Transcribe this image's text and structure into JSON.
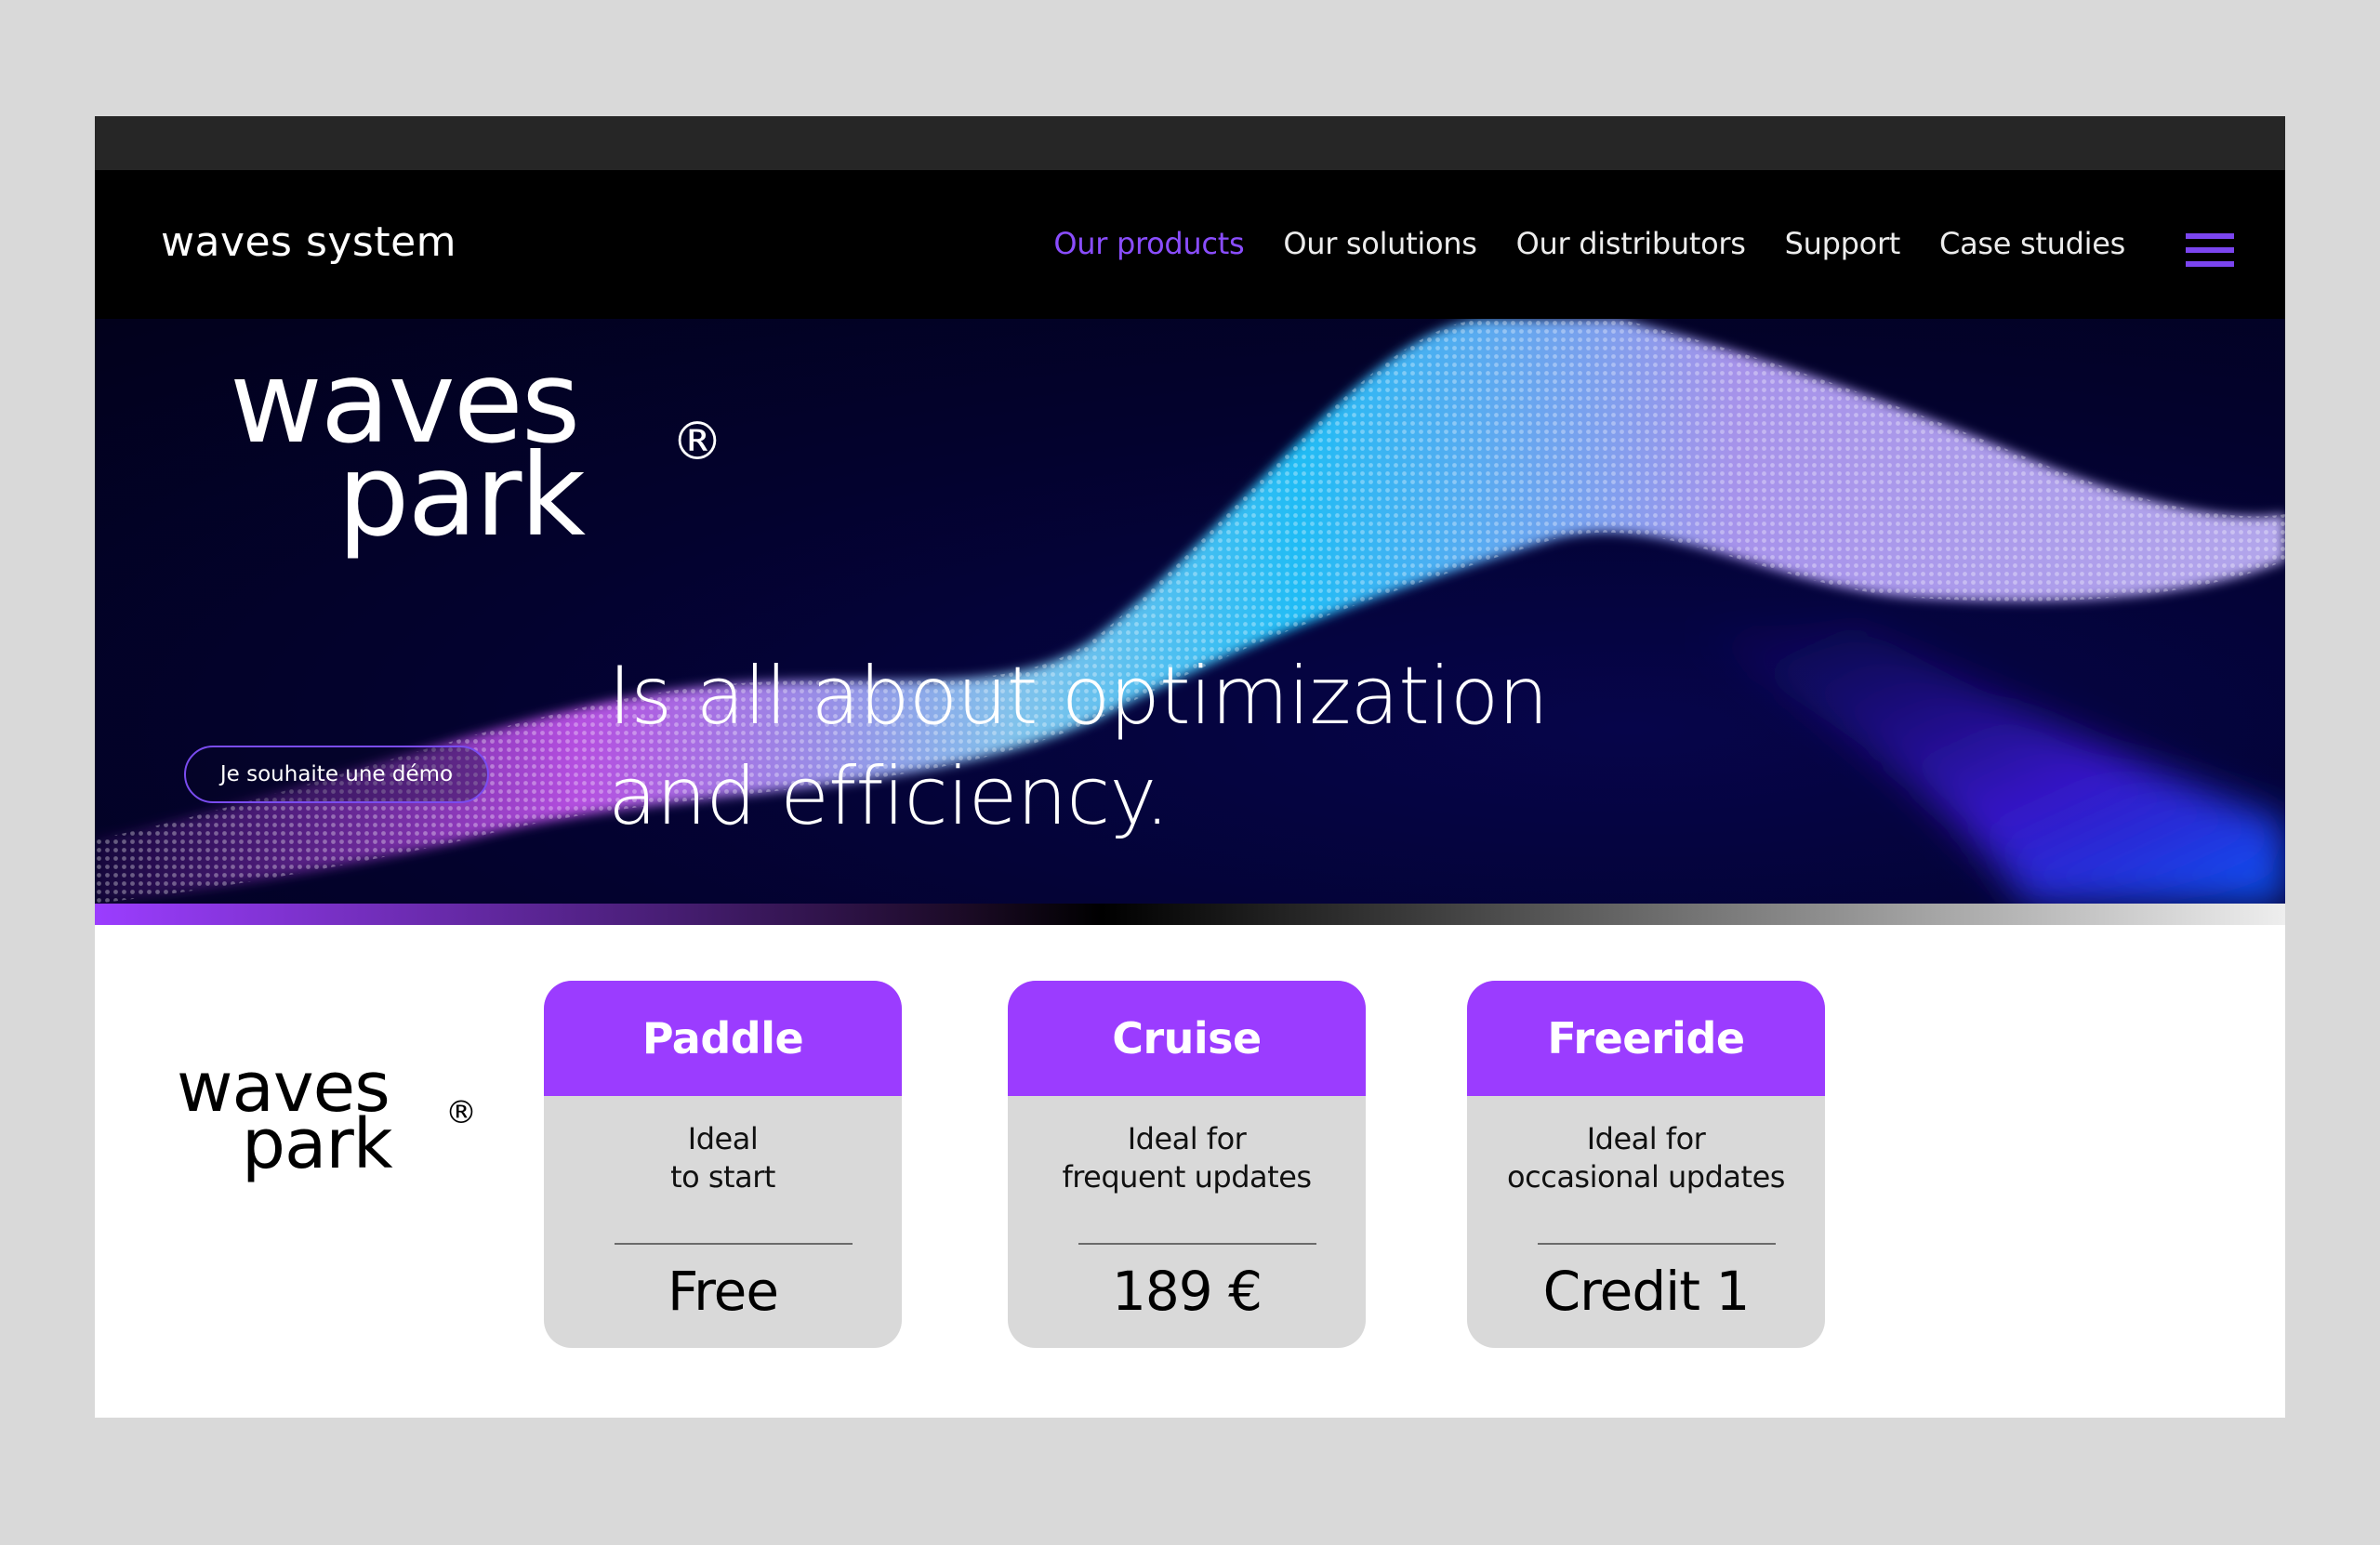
{
  "nav": {
    "brand": "waves system",
    "links": [
      {
        "label": "Our products",
        "active": true
      },
      {
        "label": "Our solutions",
        "active": false
      },
      {
        "label": "Our distributors",
        "active": false
      },
      {
        "label": "Support",
        "active": false
      },
      {
        "label": "Case studies",
        "active": false
      }
    ],
    "menu_icon": "hamburger-menu-icon"
  },
  "hero": {
    "logo_line1": "waves",
    "logo_line2": "park",
    "logo_mark": "®",
    "tagline_line1": "Is all about optimization",
    "tagline_line2": "and efficiency.",
    "demo_button": "Je souhaite une démo"
  },
  "products": {
    "logo_line1": "waves",
    "logo_line2": "park",
    "logo_mark": "®",
    "cards": [
      {
        "name": "Paddle",
        "desc_line1": "Ideal",
        "desc_line2": "to start",
        "price": "Free"
      },
      {
        "name": "Cruise",
        "desc_line1": "Ideal for",
        "desc_line2": "frequent updates",
        "price": "189 €"
      },
      {
        "name": "Freeride",
        "desc_line1": "Ideal for",
        "desc_line2": "occasional updates",
        "price": "Credit 1"
      }
    ]
  },
  "colors": {
    "accent": "#9b3cff",
    "nav_active": "#8a4dff",
    "hero_bg": "#03022e",
    "page_bg": "#d9d9d9",
    "card_bg": "#d9d9d9"
  }
}
